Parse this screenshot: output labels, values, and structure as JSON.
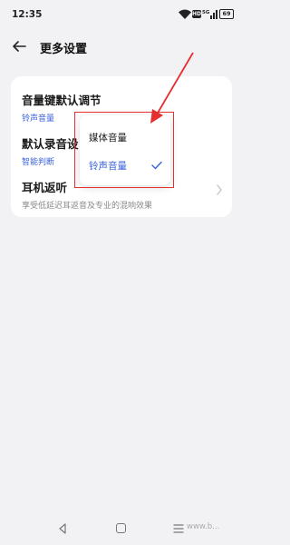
{
  "status": {
    "time": "12:35",
    "hd": "HD",
    "battery": "69"
  },
  "header": {
    "title": "更多设置"
  },
  "settings": [
    {
      "title": "音量键默认调节",
      "subtitle": "铃声音量"
    },
    {
      "title": "默认录音设",
      "subtitle": "智能判断"
    },
    {
      "title": "耳机返听",
      "subtitle": "享受低延迟耳返音及专业的混响效果"
    }
  ],
  "popup": {
    "options": [
      "媒体音量",
      "铃声音量"
    ],
    "selected": "铃声音量"
  },
  "watermark": "www.b...",
  "colors": {
    "accent": "#3a62d9",
    "highlight": "#e53030",
    "background": "#f2f2f4"
  }
}
